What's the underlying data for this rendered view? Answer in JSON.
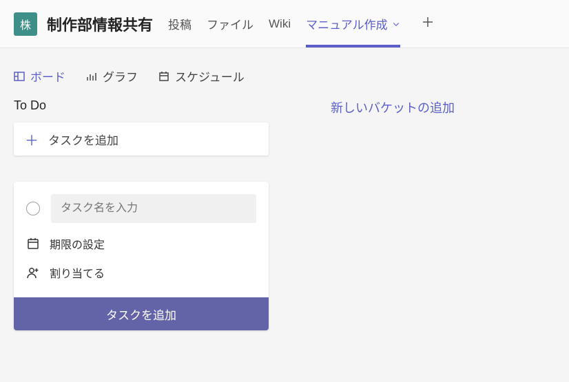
{
  "header": {
    "avatar_text": "株",
    "channel_name": "制作部情報共有",
    "tabs": {
      "posts": "投稿",
      "files": "ファイル",
      "wiki": "Wiki",
      "manual": "マニュアル作成"
    }
  },
  "views": {
    "board": "ボード",
    "chart": "グラフ",
    "schedule": "スケジュール"
  },
  "board": {
    "bucket_title": "To Do",
    "add_task_label": "タスクを追加",
    "task_name_placeholder": "タスク名を入力",
    "set_due_date": "期限の設定",
    "assign": "割り当てる",
    "submit_label": "タスクを追加",
    "new_bucket_label": "新しいバケットの追加"
  }
}
